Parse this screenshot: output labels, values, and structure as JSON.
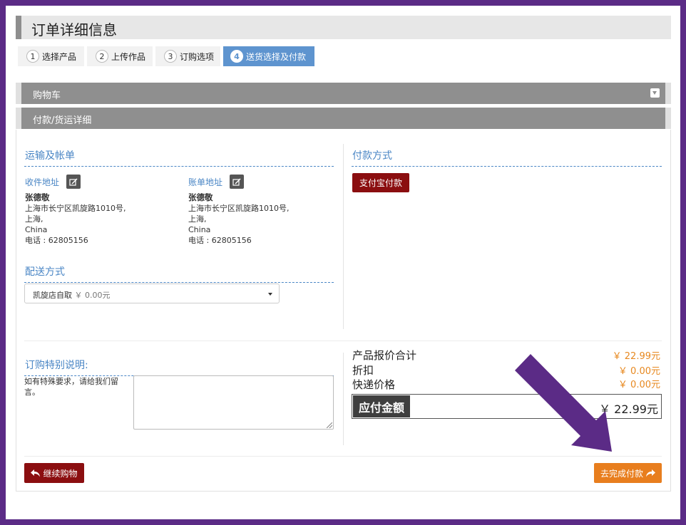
{
  "page": {
    "title": "订单详细信息"
  },
  "steps": [
    {
      "num": "1",
      "label": "选择产品",
      "active": false
    },
    {
      "num": "2",
      "label": "上传作品",
      "active": false
    },
    {
      "num": "3",
      "label": "订购选项",
      "active": false
    },
    {
      "num": "4",
      "label": "送货选择及付款",
      "active": true
    }
  ],
  "panels": {
    "cart": "购物车",
    "details": "付款/货运详细"
  },
  "shipping_billing": {
    "title": "运输及帐单",
    "shipping_label": "收件地址",
    "billing_label": "账单地址",
    "shipping": {
      "name": "张德敬",
      "line1": "上海市长宁区凯旋路1010号,",
      "line2": "上海,",
      "country": "China",
      "phone": "电话 : 62805156"
    },
    "billing": {
      "name": "张德敬",
      "line1": "上海市长宁区凯旋路1010号,",
      "line2": "上海,",
      "country": "China",
      "phone": "电话 : 62805156"
    }
  },
  "delivery": {
    "title": "配送方式",
    "selected": "凯旋店自取",
    "price": "￥ 0.00元"
  },
  "payment": {
    "title": "付款方式",
    "alipay_label": "支付宝付款"
  },
  "notes": {
    "title": "订购特别说明:",
    "hint": "如有特殊要求，请给我们留言。",
    "value": ""
  },
  "summary": {
    "subtotal_label": "产品报价合计",
    "subtotal": "￥ 22.99元",
    "discount_label": "折扣",
    "discount": "￥ 0.00元",
    "shipping_label": "快递价格",
    "shipping": "￥ 0.00元",
    "total_label": "应付金额",
    "total": "￥ 22.99元"
  },
  "actions": {
    "continue_label": "继续购物",
    "checkout_label": "去完成付款"
  },
  "colors": {
    "accent_blue": "#4a86c5",
    "dark_red": "#8b0e10",
    "orange": "#e87e1e",
    "arrow": "#5b2b86"
  }
}
